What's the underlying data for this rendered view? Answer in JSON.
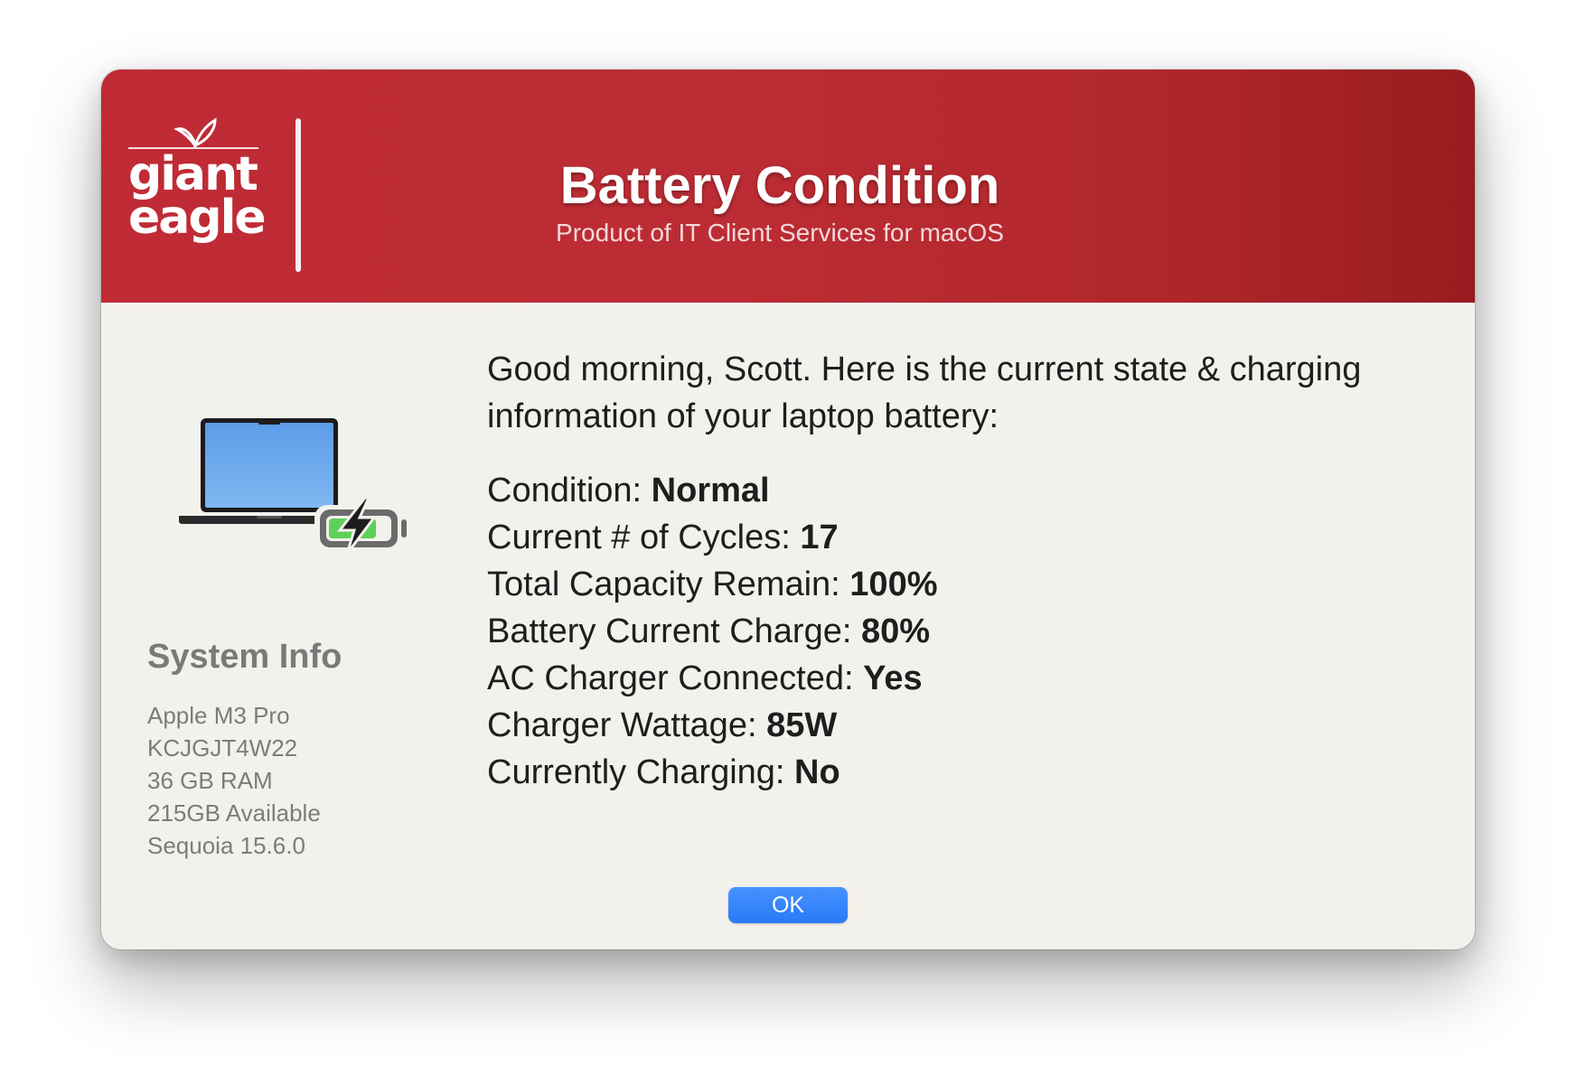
{
  "header": {
    "logo": {
      "line1": "giant",
      "line2": "eagle",
      "icon": "leaf-icon"
    },
    "title": "Battery Condition",
    "subtitle": "Product of IT Client Services for macOS"
  },
  "colors": {
    "banner": "#bc2c34",
    "banner_dark": "#991c1f",
    "background": "#f3f1ec",
    "button": "#2a7af6",
    "battery_green": "#5dd05a"
  },
  "system_info": {
    "heading": "System Info",
    "image_icon": "laptop-charging-icon",
    "items": [
      "Apple M3 Pro",
      "KCJGJT4W22",
      "36 GB RAM",
      "215GB Available",
      "Sequoia 15.6.0"
    ]
  },
  "message": {
    "greeting": "Good morning, Scott.  Here is the current state & charging information of your laptop battery:"
  },
  "details": [
    {
      "label": "Condition: ",
      "value": "Normal"
    },
    {
      "label": "Current # of Cycles: ",
      "value": "17"
    },
    {
      "label": "Total Capacity Remain: ",
      "value": "100%"
    },
    {
      "label": "Battery Current Charge: ",
      "value": "80%"
    },
    {
      "label": "AC Charger Connected: ",
      "value": "Yes"
    },
    {
      "label": "Charger Wattage: ",
      "value": "85W"
    },
    {
      "label": "Currently Charging: ",
      "value": "No"
    }
  ],
  "buttons": {
    "ok": "OK"
  }
}
